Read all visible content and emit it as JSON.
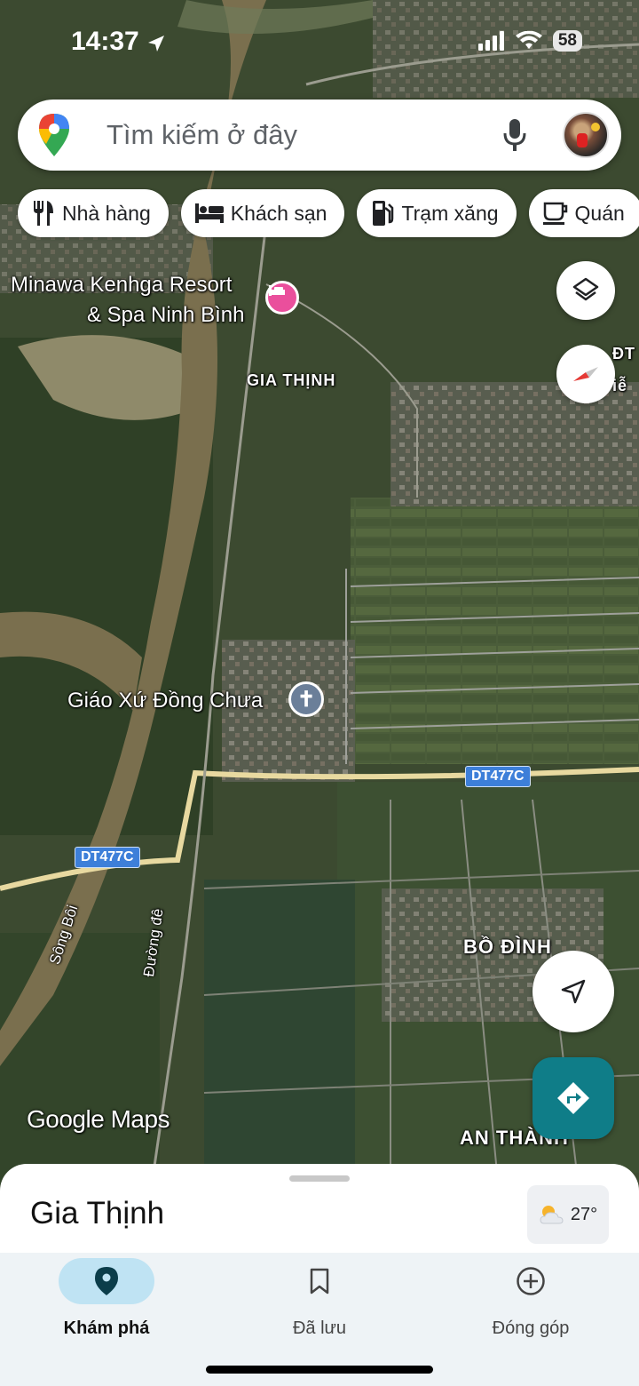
{
  "status_bar": {
    "time": "14:37",
    "battery": "58",
    "icons": [
      "location-arrow-icon",
      "signal-icon",
      "wifi-icon",
      "battery-icon"
    ]
  },
  "search": {
    "placeholder": "Tìm kiếm ở đây"
  },
  "chips": [
    {
      "icon": "restaurant-icon",
      "label": "Nhà hàng"
    },
    {
      "icon": "hotel-icon",
      "label": "Khách sạn"
    },
    {
      "icon": "gas-station-icon",
      "label": "Trạm xăng"
    },
    {
      "icon": "cafe-icon",
      "label": "Quán"
    }
  ],
  "map": {
    "labels": {
      "resort_line1": "Minawa Kenhga Resort",
      "resort_line2": "& Spa Ninh Bình",
      "gia_thinh": "GIA THỊNH",
      "parish": "Giáo Xứ Đồng Chưa",
      "bo_dinh": "BỒ ĐÌNH",
      "an_thanh": "AN THÀNH",
      "song_boi": "Sông Bôi",
      "duong_de": "Đường đê",
      "road_left": "DT477C",
      "road_right": "DT477C",
      "edge_text_1": "ĐT",
      "edge_text_2": "iễ"
    },
    "watermark": "Google Maps",
    "colors": {
      "road": "#e8d9a0",
      "river": "#7a6f4e",
      "field": "#3e4f2e"
    }
  },
  "bottom_sheet": {
    "title": "Gia Thịnh",
    "temperature": "27°",
    "weather_icon": "partly-cloudy-icon"
  },
  "nav": {
    "items": [
      {
        "label": "Khám phá",
        "icon": "pin-icon",
        "active": true
      },
      {
        "label": "Đã lưu",
        "icon": "bookmark-icon",
        "active": false
      },
      {
        "label": "Đóng góp",
        "icon": "add-circle-icon",
        "active": false
      }
    ]
  }
}
